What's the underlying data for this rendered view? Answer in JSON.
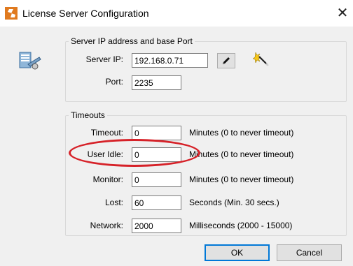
{
  "window": {
    "title": "License Server Configuration",
    "close_glyph": "✕"
  },
  "server_group": {
    "legend": "Server IP address and base Port",
    "ip_label": "Server IP:",
    "ip_value": "192.168.0.71",
    "port_label": "Port:",
    "port_value": "2235"
  },
  "timeouts": {
    "legend": "Timeouts",
    "rows": [
      {
        "label": "Timeout:",
        "value": "0",
        "unit": "Minutes (0 to never timeout)"
      },
      {
        "label": "User Idle:",
        "value": "0",
        "unit": "Minutes (0 to never timeout)"
      },
      {
        "label": "Monitor:",
        "value": "0",
        "unit": "Minutes (0 to never timeout)"
      },
      {
        "label": "Lost:",
        "value": "60",
        "unit": "Seconds (Min. 30 secs.)"
      },
      {
        "label": "Network:",
        "value": "2000",
        "unit": "Milliseconds (2000 - 15000)"
      }
    ]
  },
  "buttons": {
    "ok": "OK",
    "cancel": "Cancel"
  },
  "icons": {
    "app": "license-app-icon",
    "dialog": "server-config-icon",
    "edit": "pencil-icon",
    "wizard": "magic-wand-icon"
  },
  "colors": {
    "annotation": "#d62128",
    "default_button_border": "#0078d7",
    "app_icon": "#e07a1f"
  }
}
